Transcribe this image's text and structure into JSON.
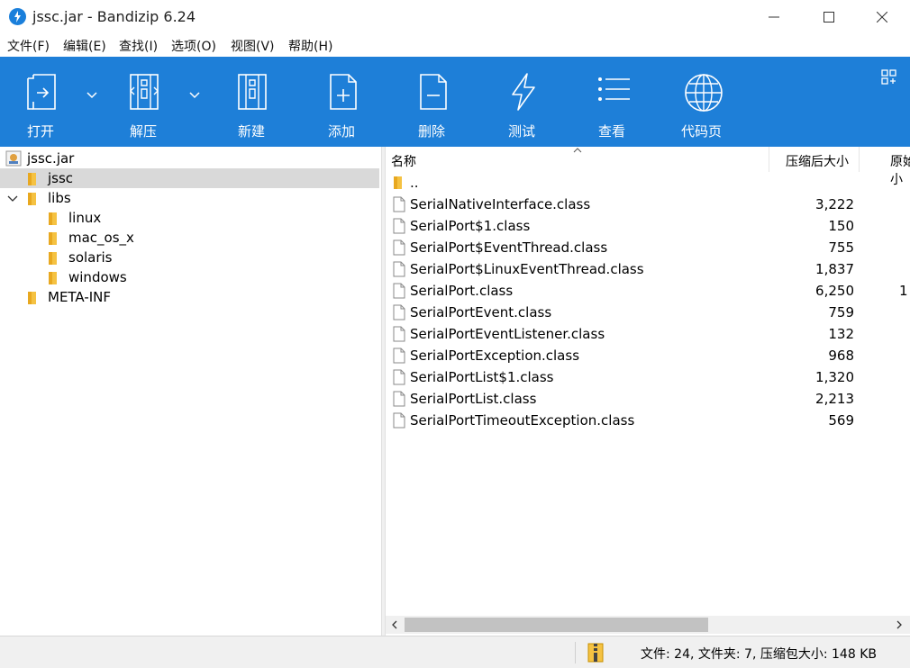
{
  "window": {
    "title": "jssc.jar - Bandizip 6.24",
    "minimize_symbol": "—",
    "maximize_symbol": "☐",
    "close_symbol": "✕"
  },
  "menu": [
    "文件(F)",
    "编辑(E)",
    "查找(I)",
    "选项(O)",
    "视图(V)",
    "帮助(H)"
  ],
  "toolbar": {
    "open_label": "打开",
    "extract_label": "解压",
    "new_label": "新建",
    "add_label": "添加",
    "delete_label": "删除",
    "test_label": "测试",
    "view_label": "查看",
    "codepage_label": "代码页",
    "color": "#1e7fd8"
  },
  "tree": {
    "root": "jssc.jar",
    "items": [
      {
        "label": "jssc",
        "selected": true
      },
      {
        "label": "libs",
        "expanded": true
      },
      {
        "label": "linux"
      },
      {
        "label": "mac_os_x"
      },
      {
        "label": "solaris"
      },
      {
        "label": "windows"
      },
      {
        "label": "META-INF"
      }
    ]
  },
  "list": {
    "columns": {
      "name": "名称",
      "packed_size": "压缩后大小",
      "original_size": "原始大小"
    },
    "parent_dir": "..",
    "files": [
      {
        "name": "SerialNativeInterface.class",
        "size": "3,222"
      },
      {
        "name": "SerialPort$1.class",
        "size": "150"
      },
      {
        "name": "SerialPort$EventThread.class",
        "size": "755"
      },
      {
        "name": "SerialPort$LinuxEventThread.class",
        "size": "1,837"
      },
      {
        "name": "SerialPort.class",
        "size": "6,250",
        "orig": "1"
      },
      {
        "name": "SerialPortEvent.class",
        "size": "759"
      },
      {
        "name": "SerialPortEventListener.class",
        "size": "132"
      },
      {
        "name": "SerialPortException.class",
        "size": "968"
      },
      {
        "name": "SerialPortList$1.class",
        "size": "1,320"
      },
      {
        "name": "SerialPortList.class",
        "size": "2,213"
      },
      {
        "name": "SerialPortTimeoutException.class",
        "size": "569"
      }
    ]
  },
  "status": {
    "text": "文件: 24, 文件夹: 7, 压缩包大小: 148 KB"
  }
}
